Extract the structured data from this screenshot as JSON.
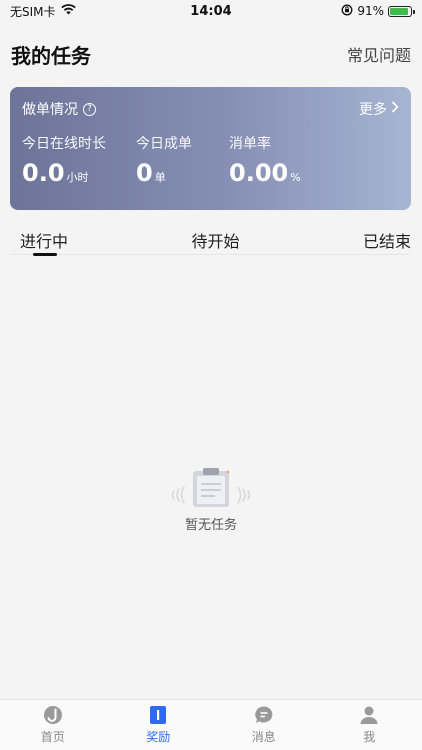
{
  "status_bar": {
    "carrier": "无SIM卡",
    "time": "14:04",
    "battery": "91%",
    "battery_level": 0.91
  },
  "header": {
    "title": "我的任务",
    "faq_label": "常见问题"
  },
  "stats_card": {
    "title": "做单情况",
    "more_label": "更多",
    "stats": [
      {
        "label": "今日在线时长",
        "value": "0.0",
        "unit": "小时"
      },
      {
        "label": "今日成单",
        "value": "0",
        "unit": "单"
      },
      {
        "label": "消单率",
        "value": "0.00",
        "unit": "%"
      }
    ]
  },
  "tabs": [
    {
      "label": "进行中",
      "active": true
    },
    {
      "label": "待开始",
      "active": false
    },
    {
      "label": "已结束",
      "active": false
    }
  ],
  "empty_state": {
    "text": "暂无任务"
  },
  "bottom_nav": [
    {
      "label": "首页",
      "icon": "home-icon",
      "active": false
    },
    {
      "label": "奖励",
      "icon": "reward-icon",
      "active": true
    },
    {
      "label": "消息",
      "icon": "message-icon",
      "active": false
    },
    {
      "label": "我",
      "icon": "profile-icon",
      "active": false
    }
  ],
  "colors": {
    "accent": "#2f6bf2",
    "card_gradient_start": "#6c7498",
    "card_gradient_end": "#a7b4d2",
    "battery_green": "#3dbe4a"
  }
}
